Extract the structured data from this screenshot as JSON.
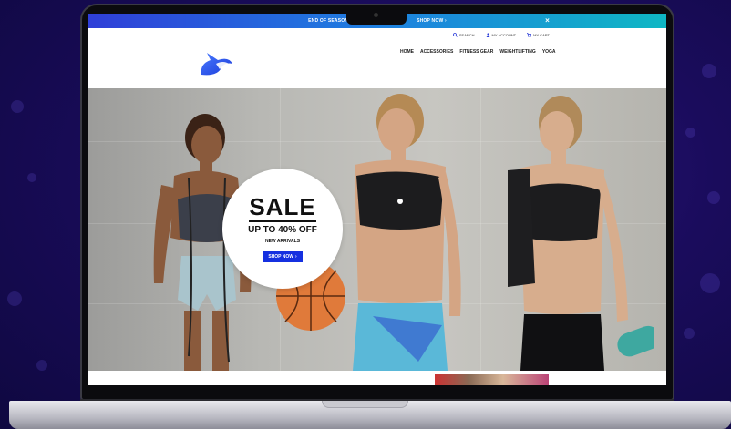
{
  "announcement": {
    "text_left": "END OF SEASON SA",
    "text_right": "SHOP NOW",
    "arrow": "›",
    "close": "×"
  },
  "utility": {
    "search": "SEARCH",
    "account": "MY ACCOUNT",
    "cart": "MY CART"
  },
  "nav": [
    "HOME",
    "ACCESSORIES",
    "FITNESS GEAR",
    "WEIGHTLIFTING",
    "YOGA"
  ],
  "hero": {
    "sale_title": "SALE",
    "sale_subtitle": "UP TO 40% OFF",
    "sale_note": "NEW ARRIVALS",
    "button_label": "SHOP NOW",
    "button_arrow": "›"
  },
  "colors": {
    "accent_blue": "#1530e0",
    "background": "#1a0c5c",
    "bar_start": "#2f3fd8",
    "bar_end": "#0fb7c4"
  },
  "icons": [
    "search-icon",
    "user-icon",
    "cart-icon",
    "close-icon",
    "logo-icon"
  ]
}
